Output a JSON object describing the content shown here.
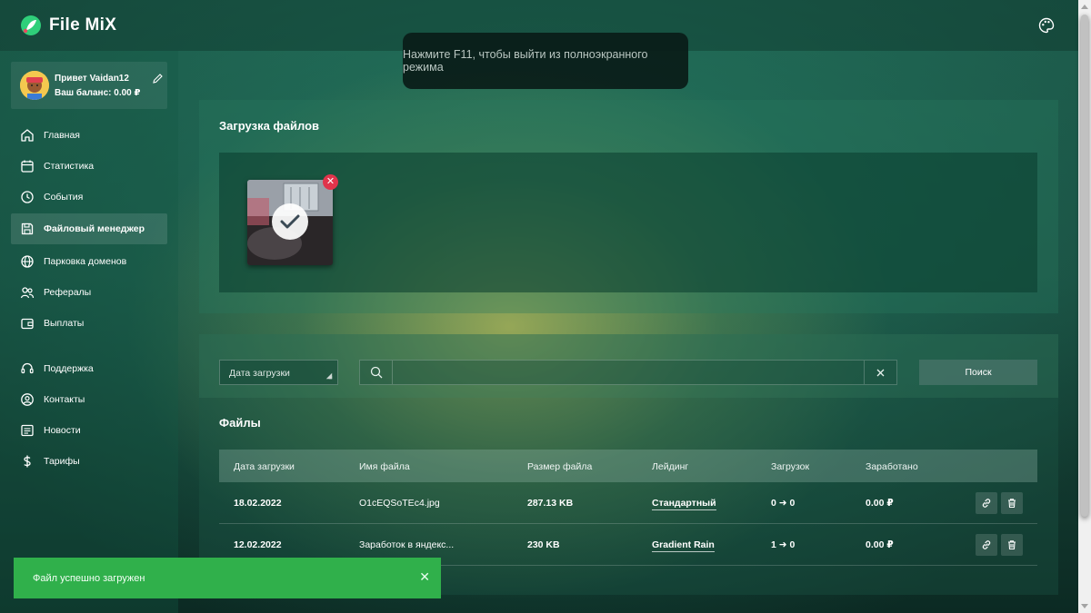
{
  "app": {
    "name": "File MiX"
  },
  "profile": {
    "greeting": "Привет Vaidan12",
    "balance": "Ваш баланс: 0.00 ₽"
  },
  "sidebar": {
    "items": [
      {
        "label": "Главная",
        "icon": "home-icon"
      },
      {
        "label": "Статистика",
        "icon": "calendar-icon"
      },
      {
        "label": "События",
        "icon": "clock-icon"
      },
      {
        "label": "Файловый менеджер",
        "icon": "save-icon",
        "active": true
      },
      {
        "label": "Парковка доменов",
        "icon": "globe-icon"
      },
      {
        "label": "Рефералы",
        "icon": "referrals-icon"
      },
      {
        "label": "Выплаты",
        "icon": "wallet-icon"
      },
      {
        "label": "Поддержка",
        "icon": "support-icon"
      },
      {
        "label": "Контакты",
        "icon": "contacts-icon"
      },
      {
        "label": "Новости",
        "icon": "news-icon"
      },
      {
        "label": "Тарифы",
        "icon": "dollar-icon"
      }
    ]
  },
  "fullscreen_notice": "Нажмите F11, чтобы выйти из полноэкранного режима",
  "upload": {
    "title": "Загрузка файлов"
  },
  "filter": {
    "date_select": "Дата загрузки",
    "search_value": "",
    "search_button": "Поиск"
  },
  "files": {
    "title": "Файлы",
    "columns": [
      "Дата загрузки",
      "Имя файла",
      "Размер файла",
      "Лейдинг",
      "Загрузок",
      "Заработано"
    ],
    "rows": [
      {
        "date": "18.02.2022",
        "name": "O1cEQSoTEc4.jpg",
        "size": "287.13 KB",
        "landing": "Стандартный",
        "downloads": "0 ➜ 0",
        "earned": "0.00 ₽"
      },
      {
        "date": "12.02.2022",
        "name": "Заработок в яндекс...",
        "size": "230 KB",
        "landing": "Gradient Rain",
        "downloads": "1 ➜ 0",
        "earned": "0.00 ₽"
      }
    ]
  },
  "toast": {
    "message": "Файл успешно загружен"
  },
  "colors": {
    "toast": "#30b04b",
    "remove_badge": "#e0344b",
    "logo_green": "#2fcf7a"
  }
}
